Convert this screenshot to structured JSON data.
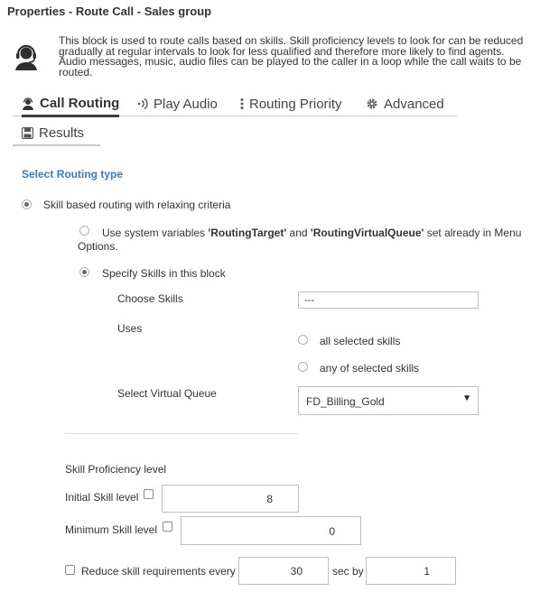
{
  "window": {
    "title": "Properties - Route Call - Sales group"
  },
  "header": {
    "icon": "agent-headset-icon",
    "description": "This block is used to route calls based on skills. Skill proficiency levels to look for can be reduced gradually at regular intervals to look for less qualified and therefore more likely to find agents. Audio messages, music, audio files can be played to the caller in a loop while the call waits to be routed."
  },
  "tabs": [
    {
      "label": "Call Routing",
      "icon": "agent-headset-icon",
      "active": true
    },
    {
      "label": "Play Audio",
      "icon": "sound-waves-icon",
      "active": false
    },
    {
      "label": "Routing Priority",
      "icon": "vertical-dots-icon",
      "active": false
    },
    {
      "label": "Advanced",
      "icon": "gear-icon",
      "active": false
    },
    {
      "label": "Results",
      "icon": "save-disk-icon",
      "active": false
    }
  ],
  "routing": {
    "section_title": "Select Routing type",
    "option_skill_relaxing": {
      "label": "Skill based routing with relaxing criteria",
      "checked": true
    },
    "option_system_vars": {
      "prefix": "Use system variables ",
      "var1": "'RoutingTarget'",
      "mid": " and ",
      "var2": "'RoutingVirtualQueue'",
      "suffix_line1": " set already in Menu",
      "suffix_line2": "Options.",
      "checked": false
    },
    "option_specify": {
      "label": "Specify Skills in this block",
      "checked": true
    },
    "choose_skills": {
      "label": "Choose Skills",
      "value": "---"
    },
    "uses": {
      "label": "Uses",
      "options": [
        {
          "label": "all selected skills",
          "checked": false
        },
        {
          "label": "any of selected skills",
          "checked": false
        }
      ]
    },
    "virtual_queue": {
      "label": "Select Virtual Queue",
      "value": "FD_Billing_Gold"
    }
  },
  "proficiency": {
    "section_title": "Skill Proficiency level",
    "initial": {
      "label": "Initial Skill level",
      "value": "8",
      "checked": false
    },
    "minimum": {
      "label": "Minimum Skill level",
      "value": "0",
      "checked": false
    },
    "reduce": {
      "label": "Reduce skill requirements every",
      "interval": "30",
      "unit_label": "sec by",
      "amount": "1",
      "checked": false
    }
  }
}
